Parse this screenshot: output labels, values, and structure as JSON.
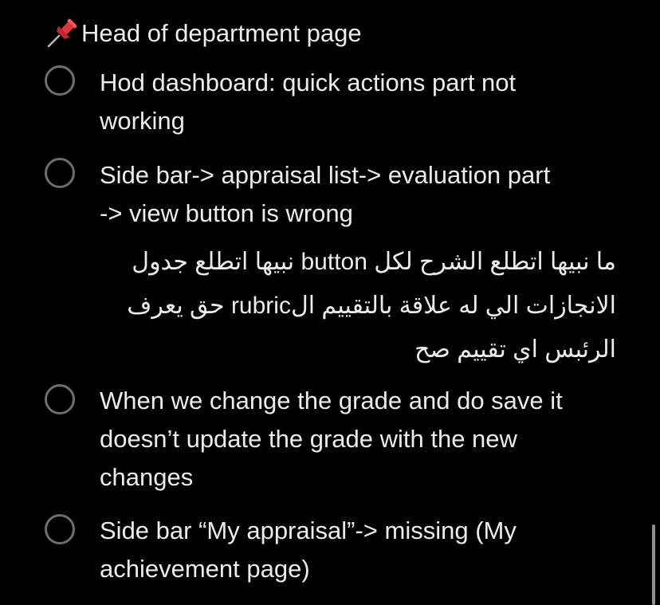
{
  "section": {
    "title": "Head of department page",
    "icon": "pushpin-icon"
  },
  "todos": [
    {
      "text": "Hod dashboard: quick actions part not\nworking",
      "checked": false
    },
    {
      "text": "Side bar-> appraisal list-> evaluation part\n-> view button is wrong",
      "checked": false,
      "note": "ما نبيها اتطلع الشرح لكل button نبيها اتطلع جدول الانجازات الي له علاقة بالتقييم الrubric حق يعرف الرئبس اي تقييم صح"
    },
    {
      "text": "When we change the grade and do save it\ndoesn’t update the grade with the new\nchanges",
      "checked": false
    },
    {
      "text": "Side bar “My appraisal”-> missing (My\nachievement page)",
      "checked": false
    }
  ],
  "colors": {
    "background": "#000000",
    "text": "#ececec",
    "checkbox_border": "#6e6e73",
    "scrollbar": "#8e8e93",
    "pin_red": "#e0343c"
  }
}
